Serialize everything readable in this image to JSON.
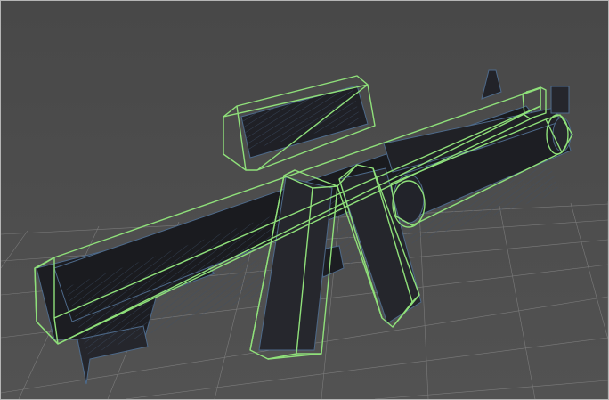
{
  "viewport": {
    "background": "#494949",
    "grid_color": "#8a8a8a",
    "mesh_fill": "#1a1b1f",
    "mesh_wire": "#4e6a8a",
    "bbox_color": "#8fe07a"
  },
  "scene": {
    "object": "rifle-mesh",
    "components": [
      "stock",
      "receiver",
      "barrel",
      "muzzle",
      "scope",
      "front-sight",
      "magazine-front",
      "magazine-rear",
      "grip",
      "grenade-launcher-tube"
    ],
    "display": {
      "wireframe_on_shaded": true,
      "bounding_boxes": true,
      "ground_grid": true
    }
  }
}
